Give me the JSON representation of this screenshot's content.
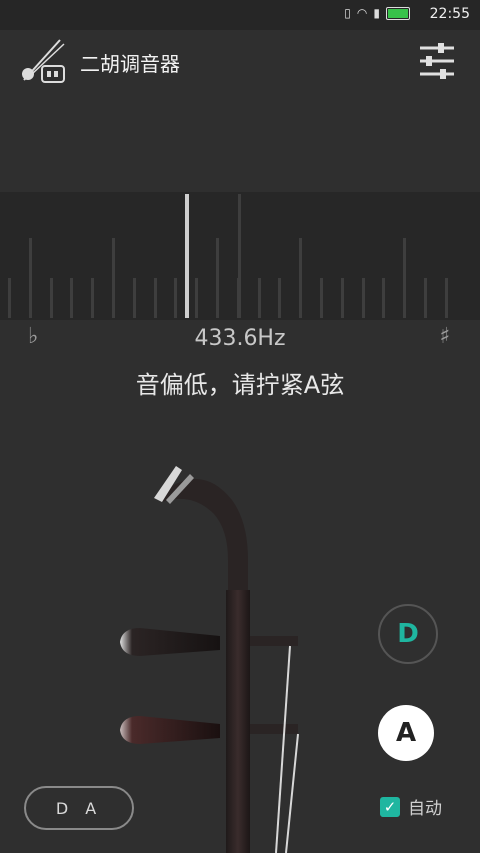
{
  "status": {
    "time": "22:55"
  },
  "app": {
    "title": "二胡调音器"
  },
  "meter": {
    "frequency": "433.6Hz",
    "flat_symbol": "♭",
    "sharp_symbol": "♯"
  },
  "message": "音偏低，请拧紧A弦",
  "strings": {
    "d_label": "D",
    "a_label": "A",
    "active": "A"
  },
  "tuning_label": "D A",
  "auto": {
    "label": "自动",
    "checked": true
  },
  "colors": {
    "accent": "#1fb6a0",
    "background": "#2f2f2f"
  }
}
